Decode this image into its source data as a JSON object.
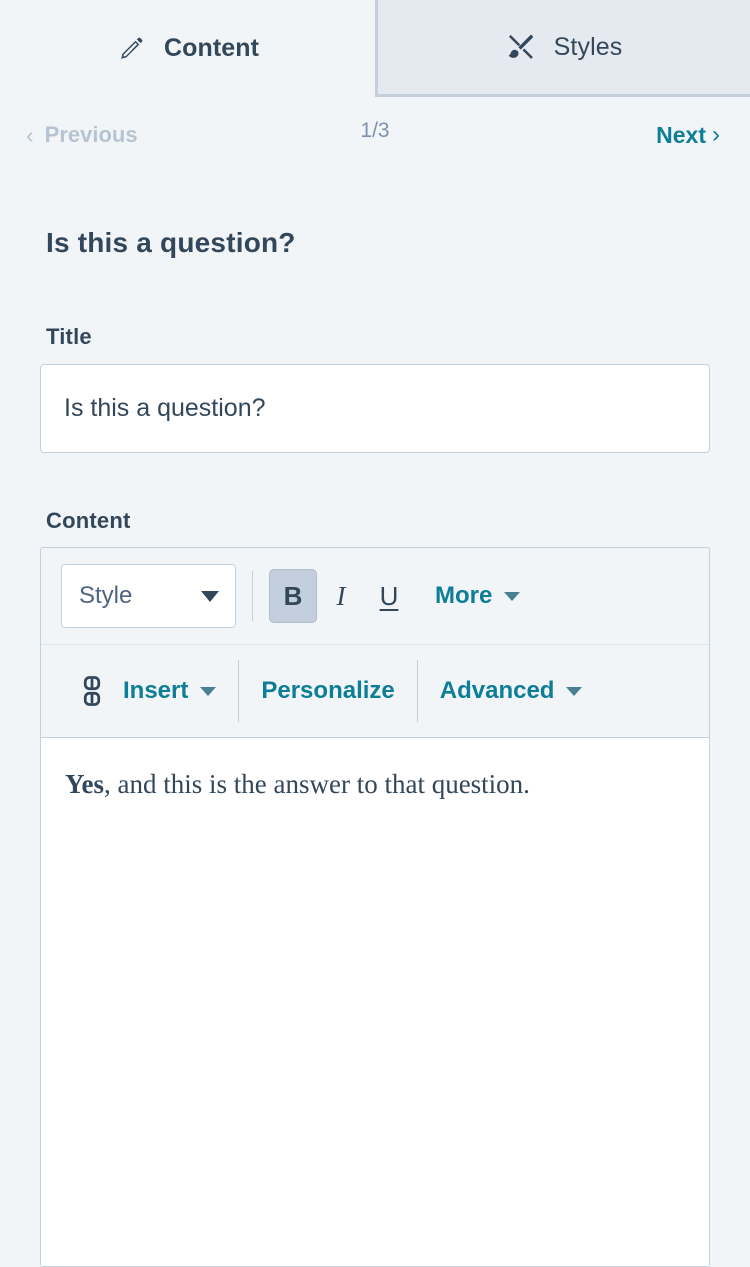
{
  "tabs": [
    {
      "label": "Content",
      "icon": "pencil-icon",
      "active": false
    },
    {
      "label": "Styles",
      "icon": "paintbrush-icon",
      "active": true
    }
  ],
  "pager": {
    "previous_label": "Previous",
    "count_label": "1/3",
    "next_label": "Next",
    "prev_chevron": "‹",
    "next_chevron": "›"
  },
  "page_title": "Is this a question?",
  "title_field": {
    "label": "Title",
    "value": "Is this a question?",
    "placeholder": "Enter a title"
  },
  "content_field": {
    "label": "Content"
  },
  "toolbar": {
    "style_select": {
      "value": "Style"
    },
    "bold_label": "B",
    "italic_label": "I",
    "underline_label": "U",
    "more_label": "More",
    "insert_label": "Insert",
    "personalize_label": "Personalize",
    "advanced_label": "Advanced"
  },
  "editor_body": {
    "bold_lead": "Yes",
    "rest": ", and this is the answer to that question."
  },
  "colors": {
    "page_background": "#f2f5f8",
    "active_tab_background": "#e5eaf1",
    "border": "#c5d0dd",
    "text": "#33475b",
    "teal_link": "#0e7d96",
    "muted": "#7c93ad",
    "disabled": "#b6c4d2",
    "active_button": "#c3cfdd"
  }
}
